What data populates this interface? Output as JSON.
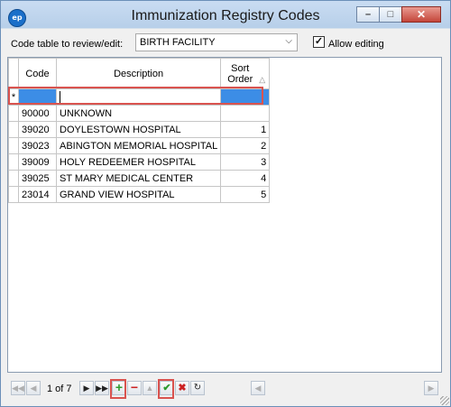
{
  "window": {
    "title": "Immunization Registry Codes",
    "app_icon_text": "ep",
    "minimize_glyph": "–",
    "maximize_glyph": "□",
    "close_glyph": "✕"
  },
  "filter": {
    "label": "Code table to review/edit:",
    "selected": "BIRTH FACILITY",
    "allow_editing_label": "Allow editing",
    "allow_editing_checked": true
  },
  "grid": {
    "headers": {
      "code": "Code",
      "description": "Description",
      "sort": "Sort Order",
      "sort_indicator": "△"
    },
    "new_row_marker": "*",
    "rows": [
      {
        "code": "90000",
        "description": "UNKNOWN",
        "sort": ""
      },
      {
        "code": "39020",
        "description": "DOYLESTOWN HOSPITAL",
        "sort": "1"
      },
      {
        "code": "39023",
        "description": "ABINGTON MEMORIAL HOSPITAL",
        "sort": "2"
      },
      {
        "code": "39009",
        "description": "HOLY REDEEMER HOSPITAL",
        "sort": "3"
      },
      {
        "code": "39025",
        "description": "ST MARY MEDICAL CENTER",
        "sort": "4"
      },
      {
        "code": "23014",
        "description": "GRAND VIEW HOSPITAL",
        "sort": "5"
      }
    ]
  },
  "navigator": {
    "position_text": "1 of 7",
    "icons": [
      "first-icon",
      "prev-icon",
      "next-icon",
      "last-icon",
      "add-icon",
      "delete-icon",
      "move-up-icon",
      "save-icon",
      "cancel-icon",
      "refresh-icon"
    ]
  },
  "colors": {
    "highlight": "#d9534f",
    "selection": "#3c8de6",
    "add": "#2e9b2e",
    "delete": "#cc2222"
  }
}
